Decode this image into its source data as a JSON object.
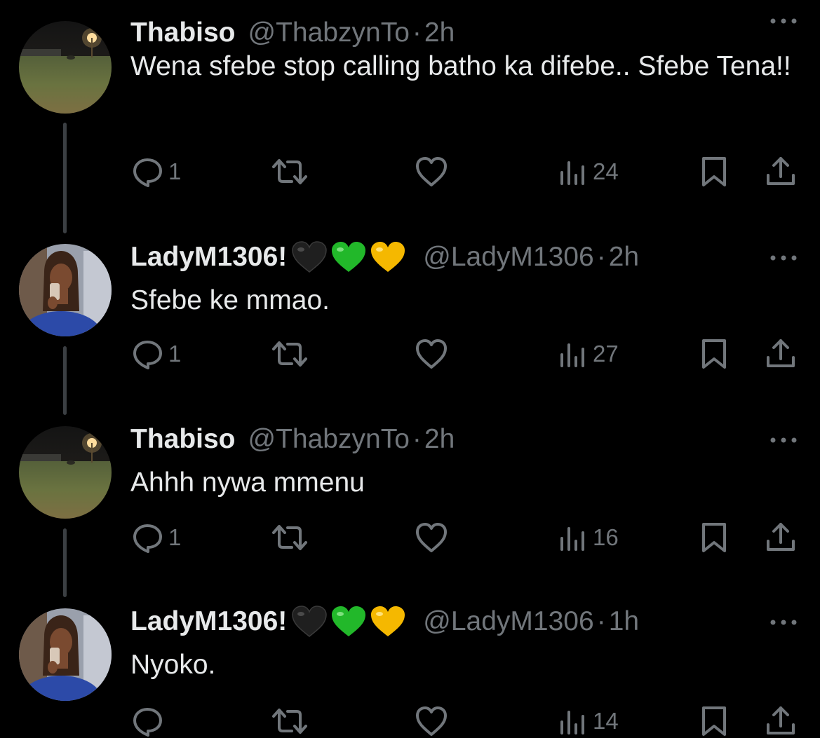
{
  "tweets": [
    {
      "display_name": "Thabiso",
      "handle": "@ThabzynTo",
      "separator": "·",
      "time": "2h",
      "text": "Wena sfebe stop calling batho ka difebe.. Sfebe Tena!!",
      "avatar": "field-at-night-avatar",
      "emojis": [],
      "replies": "1",
      "views": "24"
    },
    {
      "display_name": "LadyM1306!",
      "handle": "@LadyM1306",
      "separator": "·",
      "time": "2h",
      "text": "Sfebe ke mmao.",
      "avatar": "woman-selfie-avatar",
      "emojis": [
        "black-heart",
        "green-heart",
        "yellow-heart"
      ],
      "replies": "1",
      "views": "27"
    },
    {
      "display_name": "Thabiso",
      "handle": "@ThabzynTo",
      "separator": "·",
      "time": "2h",
      "text": "Ahhh nywa mmenu",
      "avatar": "field-at-night-avatar",
      "emojis": [],
      "replies": "1",
      "views": "16"
    },
    {
      "display_name": "LadyM1306!",
      "handle": "@LadyM1306",
      "separator": "·",
      "time": "1h",
      "text": "Nyoko.",
      "avatar": "woman-selfie-avatar",
      "emojis": [
        "black-heart",
        "green-heart",
        "yellow-heart"
      ],
      "replies": "",
      "views": "14"
    }
  ],
  "colors": {
    "background": "#000000",
    "primary_text": "#e7e9ea",
    "secondary_text": "#71767b",
    "thread_line": "#3b3f43"
  }
}
